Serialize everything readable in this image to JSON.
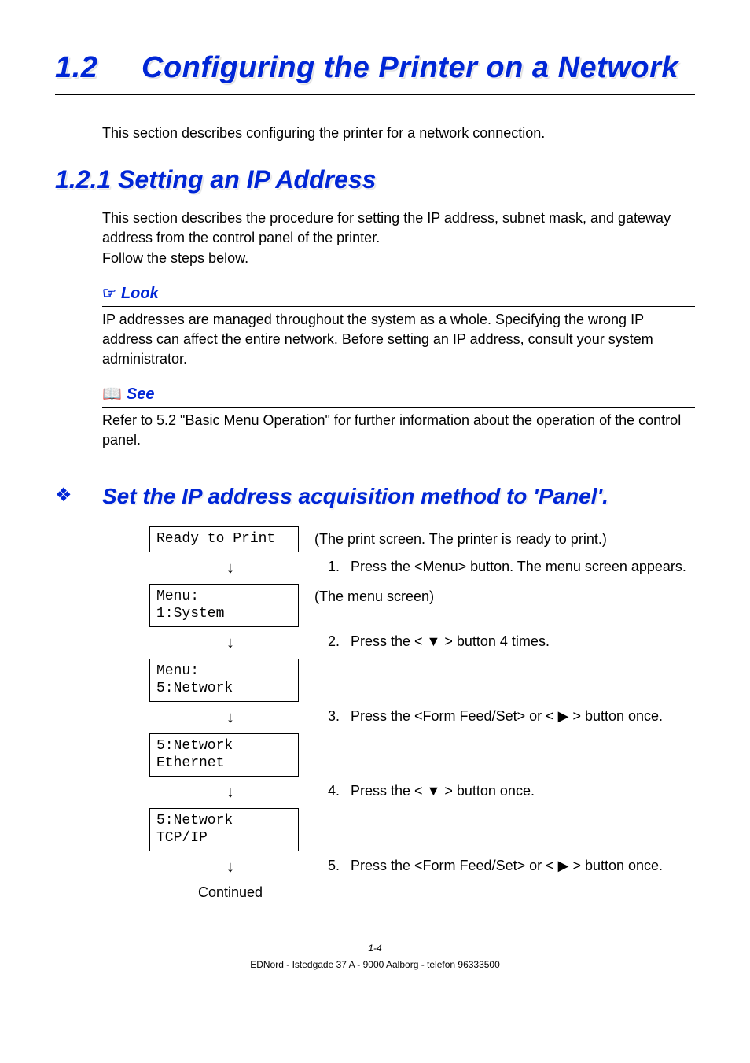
{
  "h1_num": "1.2",
  "h1_text": "Configuring the Printer on a Network",
  "intro": "This section describes configuring the printer for a network connection.",
  "h2": "1.2.1  Setting an IP Address",
  "p1": "This section describes the procedure for setting the IP address, subnet mask, and gateway address from the control panel of the printer.",
  "p1b": "Follow the steps below.",
  "look_title": "Look",
  "look_body": "IP addresses are managed throughout the system as a whole. Specifying the wrong IP address can affect the entire network. Before setting an IP address, consult your system administrator.",
  "see_title": "See",
  "see_body": "Refer to 5.2 \"Basic Menu Operation\" for further information about the operation of the control panel.",
  "h3": "Set the IP address acquisition method to 'Panel'.",
  "lcd0": "Ready to Print",
  "lcd0_note": "(The print screen. The printer is ready to print.)",
  "step1": "Press the <Menu> button. The menu screen appears.",
  "lcd1": "Menu:\n1:System",
  "lcd1_note": "(The menu screen)",
  "step2": "Press the < ▼ > button 4 times.",
  "lcd2": "Menu:\n5:Network",
  "step3": "Press the <Form Feed/Set> or < ▶ > button once.",
  "lcd3": "5:Network\nEthernet",
  "step4": "Press the < ▼ > button once.",
  "lcd4": "5:Network\nTCP/IP",
  "step5": "Press the <Form Feed/Set> or < ▶ > button once.",
  "continued": "Continued",
  "pagenum": "1-4",
  "footer": "EDNord - Istedgade 37 A - 9000 Aalborg - telefon 96333500"
}
